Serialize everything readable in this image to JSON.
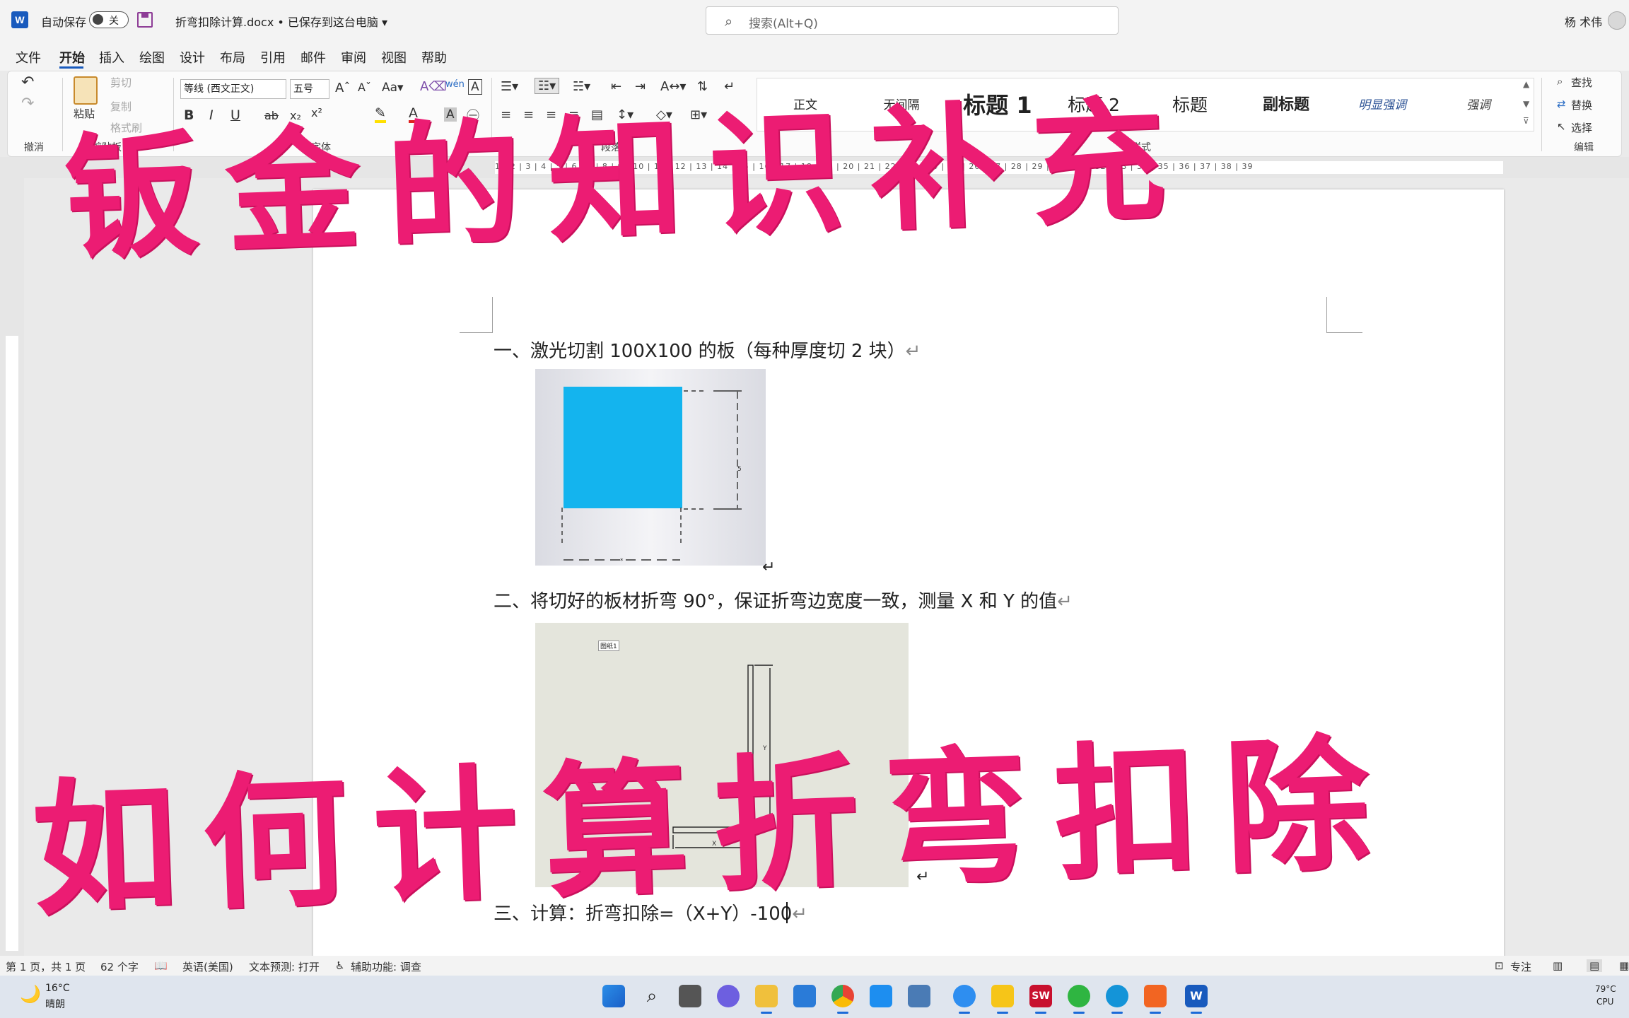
{
  "title_bar": {
    "app_icon_letter": "W",
    "autosave_label": "自动保存",
    "autosave_state": "关",
    "document_title": "折弯扣除计算.docx • 已保存到这台电脑 ▾",
    "search_placeholder": "搜索(Alt+Q)",
    "user_name": "杨 术伟"
  },
  "menu": [
    "文件",
    "开始",
    "插入",
    "绘图",
    "设计",
    "布局",
    "引用",
    "邮件",
    "审阅",
    "视图",
    "帮助"
  ],
  "active_menu": "开始",
  "ribbon": {
    "undo_group": "撤消",
    "paste": "粘贴",
    "cut": "剪切",
    "copy": "复制",
    "format_painter": "格式刷",
    "clipboard_group": "剪贴板",
    "font_name": "等线 (西文正文)",
    "font_size": "五号",
    "font_group": "字体",
    "paragraph_group": "段落",
    "styles_group": "样式",
    "styles": [
      "正文",
      "无间隔",
      "标题 1",
      "标题 2",
      "标题",
      "副标题",
      "明显强调",
      "强调"
    ],
    "find": "查找",
    "replace": "替换",
    "select": "选择",
    "editing_group": "编辑"
  },
  "ruler_numbers": "1 | 2 | 3 | 4 | 5 | 6 | 7 | 8 | 9 | 10 | 11 | 12 | 13 | 14 | 15 | 16 | 17 | 18 | 19 | 20 | 21 | 22 | 23 | 24 | 25 | 26 | 27 | 28 | 29 | 30 | 31 | 32 | 33 | 34 | 35 | 36 | 37 | 38 | 39",
  "document": {
    "line1": "一、激光切割 100X100 的板（每种厚度切 2 块）",
    "line2": "二、将切好的板材折弯 90°，保证折弯边宽度一致，测量 X 和 Y 的值",
    "line3": "三、计算：折弯扣除=（X+Y）-100",
    "paragraph_mark": "↵",
    "figure2_tag": "图纸1"
  },
  "overlay": {
    "top": "钣金的知识补充",
    "bottom": "如何计算折弯扣除"
  },
  "status_bar": {
    "page": "第 1 页，共 1 页",
    "words": "62 个字",
    "language": "英语(美国)",
    "prediction": "文本预测: 打开",
    "accessibility": "辅助功能: 调查",
    "focus": "专注"
  },
  "taskbar": {
    "weather_temp": "16°C",
    "weather_desc": "晴朗",
    "cpu_temp": "79°C",
    "cpu_label": "CPU"
  }
}
